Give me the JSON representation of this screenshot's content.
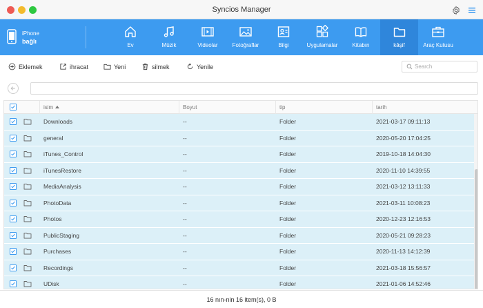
{
  "window": {
    "title": "Syncios Manager",
    "settings_icon": "gear-icon",
    "menu_icon": "hamburger-menu-icon"
  },
  "device": {
    "name": "iPhone",
    "status": "bağlı",
    "icon": "phone-icon"
  },
  "nav": {
    "tabs": [
      {
        "label": "Ev",
        "icon": "home-icon",
        "active": false
      },
      {
        "label": "Müzik",
        "icon": "music-icon",
        "active": false
      },
      {
        "label": "Videolar",
        "icon": "video-icon",
        "active": false
      },
      {
        "label": "Fotoğraflar",
        "icon": "photo-icon",
        "active": false
      },
      {
        "label": "Bilgi",
        "icon": "contact-card-icon",
        "active": false
      },
      {
        "label": "Uygulamalar",
        "icon": "apps-icon",
        "active": false
      },
      {
        "label": "Kitabın",
        "icon": "book-icon",
        "active": false
      },
      {
        "label": "kâşif",
        "icon": "folder-icon",
        "active": true
      },
      {
        "label": "Araç Kutusu",
        "icon": "toolbox-icon",
        "active": false
      }
    ],
    "colors": {
      "bar": "#3d9bf0",
      "active": "#2f86db"
    }
  },
  "toolbar": {
    "add_label": "Eklemek",
    "export_label": "ihracat",
    "new_label": "Yeni",
    "delete_label": "silmek",
    "refresh_label": "Yenile"
  },
  "search": {
    "placeholder": "Search",
    "value": ""
  },
  "path": {
    "value": ""
  },
  "table": {
    "headers": {
      "name": "isim",
      "size": "Boyut",
      "type": "tip",
      "date": "tarih"
    },
    "sort": "name-ascending",
    "rows": [
      {
        "name": "Downloads",
        "size": "--",
        "type": "Folder",
        "date": "2021-03-17 09:11:13",
        "checked": true
      },
      {
        "name": "general",
        "size": "--",
        "type": "Folder",
        "date": "2020-05-20 17:04:25",
        "checked": true
      },
      {
        "name": "iTunes_Control",
        "size": "--",
        "type": "Folder",
        "date": "2019-10-18 14:04:30",
        "checked": true
      },
      {
        "name": "iTunesRestore",
        "size": "--",
        "type": "Folder",
        "date": "2020-11-10 14:39:55",
        "checked": true
      },
      {
        "name": "MediaAnalysis",
        "size": "--",
        "type": "Folder",
        "date": "2021-03-12 13:11:33",
        "checked": true
      },
      {
        "name": "PhotoData",
        "size": "--",
        "type": "Folder",
        "date": "2021-03-11 10:08:23",
        "checked": true
      },
      {
        "name": "Photos",
        "size": "--",
        "type": "Folder",
        "date": "2020-12-23 12:16:53",
        "checked": true
      },
      {
        "name": "PublicStaging",
        "size": "--",
        "type": "Folder",
        "date": "2020-05-21 09:28:23",
        "checked": true
      },
      {
        "name": "Purchases",
        "size": "--",
        "type": "Folder",
        "date": "2020-11-13 14:12:39",
        "checked": true
      },
      {
        "name": "Recordings",
        "size": "--",
        "type": "Folder",
        "date": "2021-03-18 15:56:57",
        "checked": true
      },
      {
        "name": "UDisk",
        "size": "--",
        "type": "Folder",
        "date": "2021-01-06 14:52:46",
        "checked": true
      }
    ],
    "row_color": "#dcf0f8"
  },
  "status": {
    "text": "16 nın-nin 16 item(s), 0 B"
  }
}
